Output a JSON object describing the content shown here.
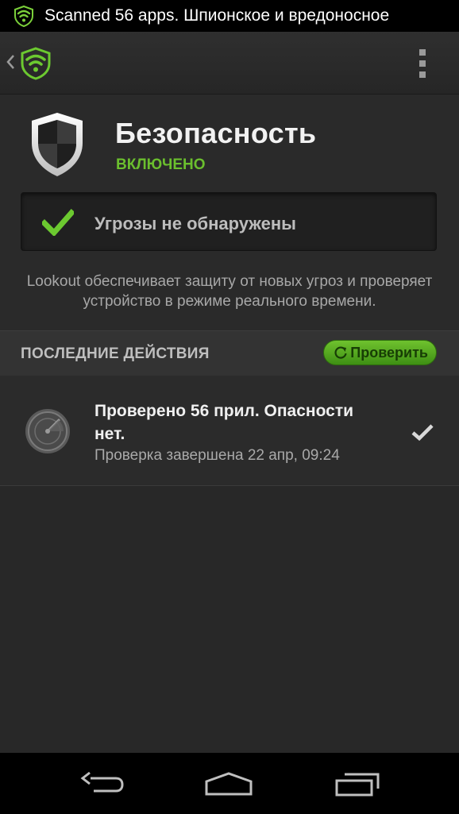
{
  "status_bar": {
    "notification_icon": "lookout-shield-icon",
    "text": "Scanned 56 apps.  Шпионское и вредоносное"
  },
  "action_bar": {
    "up_icon": "chevron-left-icon",
    "logo_icon": "lookout-logo-icon",
    "menu_icon": "overflow-menu-icon"
  },
  "security": {
    "icon": "shield-icon",
    "title": "Безопасность",
    "status": "ВКЛЮЧЕНО"
  },
  "threat_panel": {
    "icon": "check-icon",
    "text": "Угрозы не обнаружены"
  },
  "description": "Lookout обеспечивает защиту от новых угроз и проверяет устройство в режиме реального времени.",
  "recent": {
    "title": "ПОСЛЕДНИЕ ДЕЙСТВИЯ",
    "scan_button_label": "Проверить",
    "scan_button_icon": "refresh-icon"
  },
  "activity": {
    "icon": "radar-icon",
    "title": "Проверено 56 прил. Опасности нет.",
    "subtitle": "Проверка завершена 22 апр, 09:24",
    "status_icon": "check-icon"
  },
  "nav_bar": {
    "back_icon": "back-icon",
    "home_icon": "home-icon",
    "recents_icon": "recents-icon"
  },
  "colors": {
    "accent_green": "#6bbf2e",
    "background": "#2a2a2a",
    "status_bar": "#000000"
  }
}
